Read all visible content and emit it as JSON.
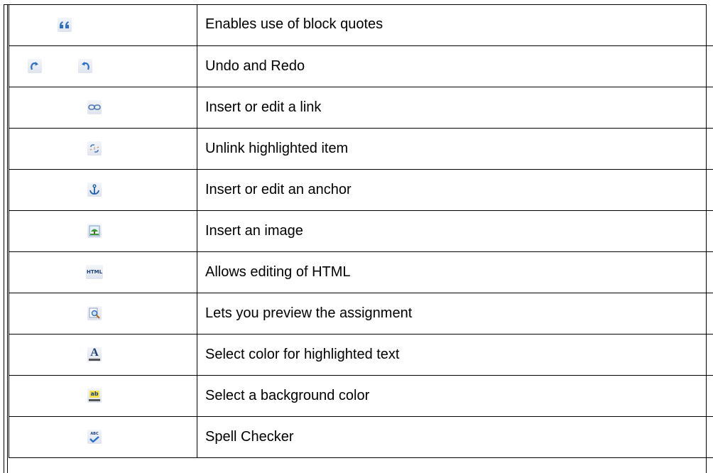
{
  "rows": [
    {
      "icon": "blockquote-icon",
      "description": "Enables use of block quotes"
    },
    {
      "icon": "undo-redo-icons",
      "description": "Undo and Redo"
    },
    {
      "icon": "link-icon",
      "description": "Insert or edit a link"
    },
    {
      "icon": "unlink-icon",
      "description": "Unlink highlighted item"
    },
    {
      "icon": "anchor-icon",
      "description": "Insert or edit an anchor"
    },
    {
      "icon": "image-icon",
      "description": "Insert an image"
    },
    {
      "icon": "html-icon",
      "description": "Allows editing of HTML",
      "icon_text": "HTML"
    },
    {
      "icon": "preview-icon",
      "description": "Lets you preview the assignment"
    },
    {
      "icon": "text-color-icon",
      "description": "Select color for highlighted text",
      "icon_text": "A"
    },
    {
      "icon": "background-color-icon",
      "description": "Select a background color",
      "icon_text": "ab"
    },
    {
      "icon": "spellcheck-icon",
      "description": "Spell Checker",
      "icon_text": "ABC"
    }
  ],
  "colors": {
    "icon_blue": "#2d6fc4",
    "icon_dark_blue": "#1f3f7a",
    "image_green": "#3f9a2e",
    "highlight_yellow": "#f3e24a"
  }
}
